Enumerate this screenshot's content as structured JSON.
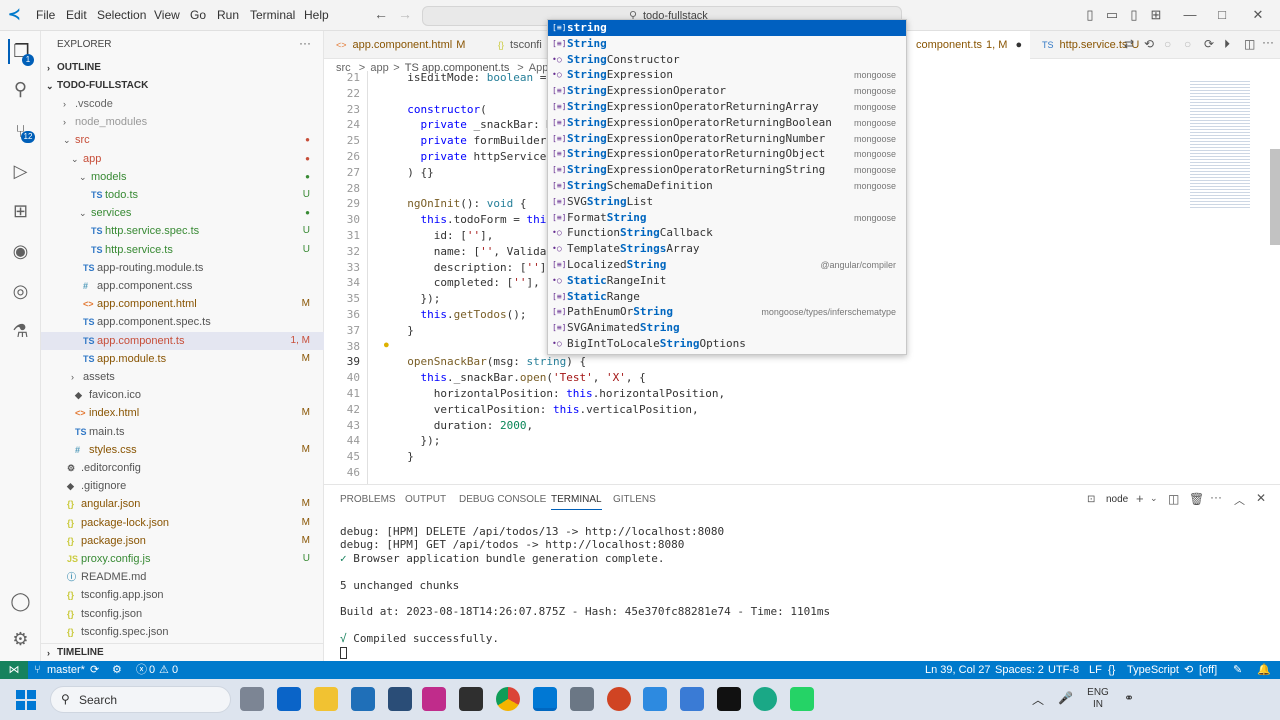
{
  "title_bar": {
    "menus": [
      "File",
      "Edit",
      "Selection",
      "View",
      "Go",
      "Run",
      "Terminal",
      "Help"
    ],
    "search_text": "todo-fullstack"
  },
  "explorer": {
    "header": "EXPLORER",
    "outline": "OUTLINE",
    "timeline": "TIMELINE",
    "project": "TODO-FULLSTACK",
    "items": [
      {
        "label": ".vscode",
        "indent": 0,
        "folder": true,
        "icon": "",
        "status": "",
        "color": "#666"
      },
      {
        "label": "node_modules",
        "indent": 0,
        "folder": true,
        "icon": "",
        "status": "",
        "color": "#999"
      },
      {
        "label": "src",
        "indent": 0,
        "folder": true,
        "open": true,
        "icon": "",
        "status": "dot",
        "color": "#c74e39"
      },
      {
        "label": "app",
        "indent": 1,
        "folder": true,
        "open": true,
        "icon": "",
        "status": "dot",
        "color": "#c74e39"
      },
      {
        "label": "models",
        "indent": 2,
        "folder": true,
        "open": true,
        "icon": "",
        "status": "dotg",
        "color": "#388a34"
      },
      {
        "label": "todo.ts",
        "indent": 3,
        "icon": "TS",
        "status": "U",
        "color": "#388a34"
      },
      {
        "label": "services",
        "indent": 2,
        "folder": true,
        "open": true,
        "icon": "",
        "status": "dotg",
        "color": "#388a34"
      },
      {
        "label": "http.service.spec.ts",
        "indent": 3,
        "icon": "TS",
        "status": "U",
        "color": "#388a34"
      },
      {
        "label": "http.service.ts",
        "indent": 3,
        "icon": "TS",
        "status": "U",
        "color": "#388a34"
      },
      {
        "label": "app-routing.module.ts",
        "indent": 2,
        "icon": "TS",
        "status": "",
        "color": "#555"
      },
      {
        "label": "app.component.css",
        "indent": 2,
        "icon": "#",
        "status": "",
        "color": "#555"
      },
      {
        "label": "app.component.html",
        "indent": 2,
        "icon": "<>",
        "status": "M",
        "color": "#895503"
      },
      {
        "label": "app.component.spec.ts",
        "indent": 2,
        "icon": "TS",
        "status": "",
        "color": "#555"
      },
      {
        "label": "app.component.ts",
        "indent": 2,
        "icon": "TS",
        "status": "1, M",
        "color": "#c74e39",
        "selected": true
      },
      {
        "label": "app.module.ts",
        "indent": 2,
        "icon": "TS",
        "status": "M",
        "color": "#895503"
      },
      {
        "label": "assets",
        "indent": 1,
        "folder": true,
        "icon": "",
        "status": "",
        "color": "#555"
      },
      {
        "label": "favicon.ico",
        "indent": 1,
        "icon": "◆",
        "status": "",
        "color": "#555"
      },
      {
        "label": "index.html",
        "indent": 1,
        "icon": "<>",
        "status": "M",
        "color": "#895503"
      },
      {
        "label": "main.ts",
        "indent": 1,
        "icon": "TS",
        "status": "",
        "color": "#555"
      },
      {
        "label": "styles.css",
        "indent": 1,
        "icon": "#",
        "status": "M",
        "color": "#895503"
      },
      {
        "label": ".editorconfig",
        "indent": 0,
        "icon": "⚙",
        "status": "",
        "color": "#555"
      },
      {
        "label": ".gitignore",
        "indent": 0,
        "icon": "◆",
        "status": "",
        "color": "#555"
      },
      {
        "label": "angular.json",
        "indent": 0,
        "icon": "{}",
        "status": "M",
        "color": "#895503"
      },
      {
        "label": "package-lock.json",
        "indent": 0,
        "icon": "{}",
        "status": "M",
        "color": "#895503"
      },
      {
        "label": "package.json",
        "indent": 0,
        "icon": "{}",
        "status": "M",
        "color": "#895503"
      },
      {
        "label": "proxy.config.js",
        "indent": 0,
        "icon": "JS",
        "status": "U",
        "color": "#388a34"
      },
      {
        "label": "README.md",
        "indent": 0,
        "icon": "ⓘ",
        "status": "",
        "color": "#555"
      },
      {
        "label": "tsconfig.app.json",
        "indent": 0,
        "icon": "{}",
        "status": "",
        "color": "#555"
      },
      {
        "label": "tsconfig.json",
        "indent": 0,
        "icon": "{}",
        "status": "",
        "color": "#555"
      },
      {
        "label": "tsconfig.spec.json",
        "indent": 0,
        "icon": "{}",
        "status": "",
        "color": "#555"
      }
    ]
  },
  "tabs": [
    {
      "label": "app.component.html",
      "status": "M",
      "icon": "<>"
    },
    {
      "label": "tsconfi",
      "status": "",
      "icon": "{}"
    },
    {
      "label": "component.ts",
      "status": "1, M",
      "icon": "",
      "active": true
    },
    {
      "label": "http.service.ts",
      "status": "U",
      "icon": "TS"
    }
  ],
  "breadcrumb": [
    "src",
    ">",
    "app",
    ">",
    "TS app.component.ts",
    ">",
    "App"
  ],
  "code_lines": [
    {
      "n": "21",
      "html": "  isEditMode: boolean = fa"
    },
    {
      "n": "22",
      "html": ""
    },
    {
      "n": "23",
      "html": "  constructor("
    },
    {
      "n": "24",
      "html": "    private _snackBar: Mat"
    },
    {
      "n": "25",
      "html": "    private formBuilder: F"
    },
    {
      "n": "26",
      "html": "    private httpService: H"
    },
    {
      "n": "27",
      "html": "  ) {}"
    },
    {
      "n": "28",
      "html": ""
    },
    {
      "n": "29",
      "html": "  ngOnInit(): void {"
    },
    {
      "n": "30",
      "html": "    this.todoForm = this.f"
    },
    {
      "n": "31",
      "html": "      id: [''],"
    },
    {
      "n": "32",
      "html": "      name: ['', Validator"
    },
    {
      "n": "33",
      "html": "      description: [''],"
    },
    {
      "n": "34",
      "html": "      completed: [''],"
    },
    {
      "n": "35",
      "html": "    });"
    },
    {
      "n": "36",
      "html": "    this.getTodos();"
    },
    {
      "n": "37",
      "html": "  }"
    },
    {
      "n": "38",
      "html": ""
    },
    {
      "n": "39",
      "html": "  openSnackBar(msg: string) {"
    },
    {
      "n": "40",
      "html": "    this._snackBar.open('Test', 'X', {"
    },
    {
      "n": "41",
      "html": "      horizontalPosition: this.horizontalPosition,"
    },
    {
      "n": "42",
      "html": "      verticalPosition: this.verticalPosition,"
    },
    {
      "n": "43",
      "html": "      duration: 2000,"
    },
    {
      "n": "44",
      "html": "    });"
    },
    {
      "n": "45",
      "html": "  }"
    },
    {
      "n": "46",
      "html": ""
    }
  ],
  "suggestions": [
    {
      "icon": "[≡]",
      "pre": "",
      "match": "string",
      "post": "",
      "detail": ""
    },
    {
      "icon": "[≡]",
      "pre": "",
      "match": "String",
      "post": "",
      "detail": ""
    },
    {
      "icon": "•○",
      "pre": "",
      "match": "String",
      "post": "Constructor",
      "detail": ""
    },
    {
      "icon": "•○",
      "pre": "",
      "match": "String",
      "post": "Expression",
      "detail": "mongoose"
    },
    {
      "icon": "[≡]",
      "pre": "",
      "match": "String",
      "post": "ExpressionOperator",
      "detail": "mongoose"
    },
    {
      "icon": "[≡]",
      "pre": "",
      "match": "String",
      "post": "ExpressionOperatorReturningArray",
      "detail": "mongoose"
    },
    {
      "icon": "[≡]",
      "pre": "",
      "match": "String",
      "post": "ExpressionOperatorReturningBoolean",
      "detail": "mongoose"
    },
    {
      "icon": "[≡]",
      "pre": "",
      "match": "String",
      "post": "ExpressionOperatorReturningNumber",
      "detail": "mongoose"
    },
    {
      "icon": "[≡]",
      "pre": "",
      "match": "String",
      "post": "ExpressionOperatorReturningObject",
      "detail": "mongoose"
    },
    {
      "icon": "[≡]",
      "pre": "",
      "match": "String",
      "post": "ExpressionOperatorReturningString",
      "detail": "mongoose"
    },
    {
      "icon": "[≡]",
      "pre": "",
      "match": "String",
      "post": "SchemaDefinition",
      "detail": "mongoose"
    },
    {
      "icon": "[≡]",
      "pre": "SVG",
      "match": "String",
      "post": "List",
      "detail": ""
    },
    {
      "icon": "[≡]",
      "pre": "Format",
      "match": "String",
      "post": "",
      "detail": "mongoose"
    },
    {
      "icon": "•○",
      "pre": "Function",
      "match": "String",
      "post": "Callback",
      "detail": ""
    },
    {
      "icon": "•○",
      "pre": "Template",
      "match": "Strings",
      "post": "Array",
      "detail": ""
    },
    {
      "icon": "[≡]",
      "pre": "Localized",
      "match": "String",
      "post": "",
      "detail": "@angular/compiler"
    },
    {
      "icon": "•○",
      "pre": "",
      "match": "Static",
      "post": "RangeInit",
      "detail": ""
    },
    {
      "icon": "[≡]",
      "pre": "",
      "match": "Static",
      "post": "Range",
      "detail": ""
    },
    {
      "icon": "[≡]",
      "pre": "PathEnumOr",
      "match": "String",
      "post": "",
      "detail": "mongoose/types/inferschematype"
    },
    {
      "icon": "[≡]",
      "pre": "SVGAnimated",
      "match": "String",
      "post": "",
      "detail": ""
    },
    {
      "icon": "•○",
      "pre": "BigIntToLocale",
      "match": "String",
      "post": "Options",
      "detail": ""
    }
  ],
  "panel": {
    "tabs": [
      "PROBLEMS",
      "OUTPUT",
      "DEBUG CONSOLE",
      "TERMINAL",
      "GITLENS"
    ],
    "active": "TERMINAL",
    "shell": "node",
    "lines": [
      "debug: [HPM] DELETE /api/todos/13 -> http://localhost:8080",
      "debug: [HPM] GET /api/todos -> http://localhost:8080",
      "✓ Browser application bundle generation complete.",
      "",
      "5 unchanged chunks",
      "",
      "Build at: 2023-08-18T14:26:07.875Z - Hash: 45e370fc88281e74 - Time: 1101ms",
      "",
      "√ Compiled successfully."
    ]
  },
  "status": {
    "branch": "master*",
    "errors": "0",
    "warnings": "0",
    "position": "Ln 39, Col 27",
    "spaces": "Spaces: 2",
    "encoding": "UTF-8",
    "eol": "LF",
    "language": "TypeScript",
    "prettier": "[off]"
  },
  "taskbar": {
    "search": "Search",
    "lang": "ENG",
    "region": "IN"
  },
  "badges": {
    "explorer": "1",
    "scm": "12"
  }
}
